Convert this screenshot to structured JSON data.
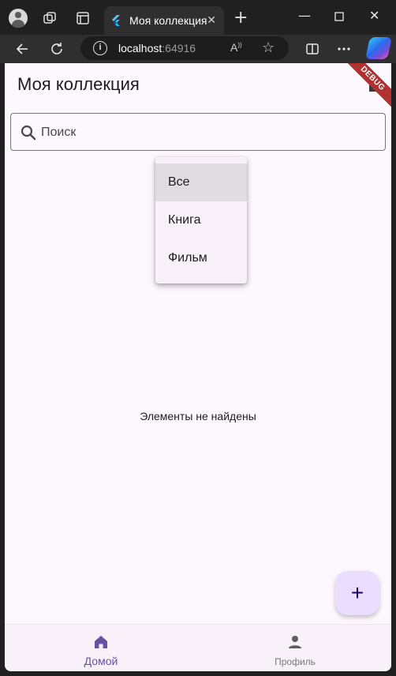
{
  "browser": {
    "tab_title": "Моя коллекция",
    "url_host": "localhost",
    "url_port": ":64916",
    "reader_label": "A",
    "icons": [
      "profile-icon",
      "workspaces-icon",
      "tab-actions-icon",
      "flutter-favicon",
      "close-icon",
      "new-tab-icon",
      "minimize-icon",
      "maximize-icon",
      "window-close-icon",
      "back-icon",
      "refresh-icon",
      "site-info-icon",
      "read-aloud-icon",
      "favorite-star-icon",
      "split-screen-icon",
      "more-icon",
      "copilot-icon"
    ]
  },
  "app": {
    "title": "Моя коллекция",
    "debug_banner": "DEBUG",
    "search": {
      "placeholder": "Поиск",
      "value": ""
    },
    "filter_menu": {
      "selected": "Все",
      "options": [
        "Все",
        "Книга",
        "Фильм"
      ]
    },
    "empty_message": "Элементы не найдены",
    "fab_label": "+",
    "bottom_nav": {
      "items": [
        {
          "label": "Домой",
          "icon": "home-icon",
          "active": true
        },
        {
          "label": "Профиль",
          "icon": "person-icon",
          "active": false
        }
      ]
    },
    "colors": {
      "background": "#fdf7fe",
      "primary": "#6750a4",
      "fab": "#eaddff",
      "menu_selected": "#e1dbe2"
    }
  }
}
